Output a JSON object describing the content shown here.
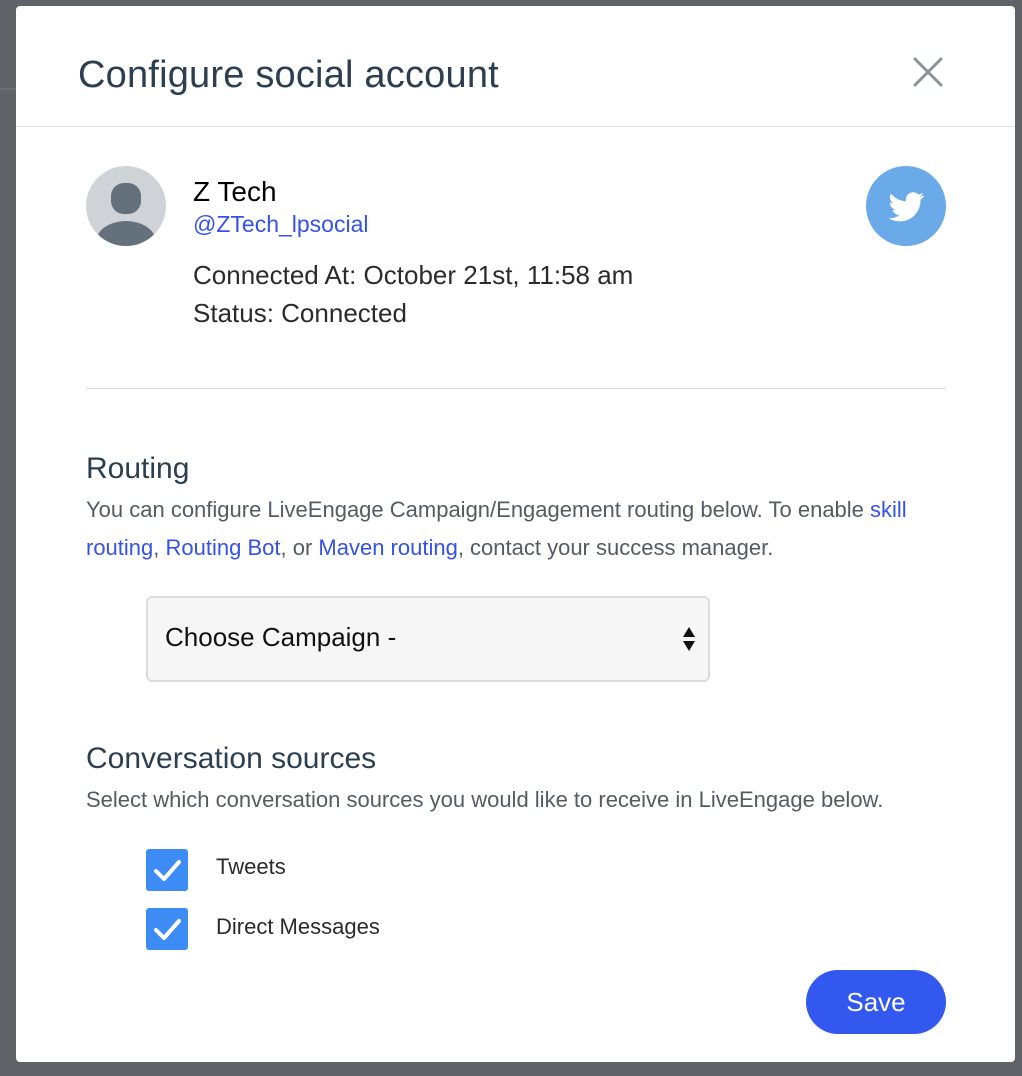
{
  "modal": {
    "title": "Configure social account"
  },
  "account": {
    "name": "Z Tech",
    "handle": "@ZTech_lpsocial",
    "connected_at": "Connected At: October 21st, 11:58 am",
    "status": "Status: Connected",
    "network_icon": "twitter-icon"
  },
  "routing": {
    "title": "Routing",
    "desc_before": "You can configure LiveEngage Campaign/Engagement routing below. To enable ",
    "link_skill": "skill routing",
    "sep1": ", ",
    "link_bot": "Routing Bot",
    "sep2": ", or ",
    "link_maven": "Maven routing",
    "desc_after": ", contact your success manager.",
    "select_value": "Choose Campaign -"
  },
  "sources": {
    "title": "Conversation sources",
    "desc": "Select which conversation sources you would like to receive in LiveEngage below.",
    "items": [
      {
        "label": "Tweets",
        "checked": true
      },
      {
        "label": "Direct Messages",
        "checked": true
      }
    ]
  },
  "actions": {
    "save_label": "Save"
  },
  "colors": {
    "accent": "#3358f0",
    "link": "#3452e8",
    "checkbox": "#3d8cf5",
    "twitter": "#6aaae8"
  }
}
